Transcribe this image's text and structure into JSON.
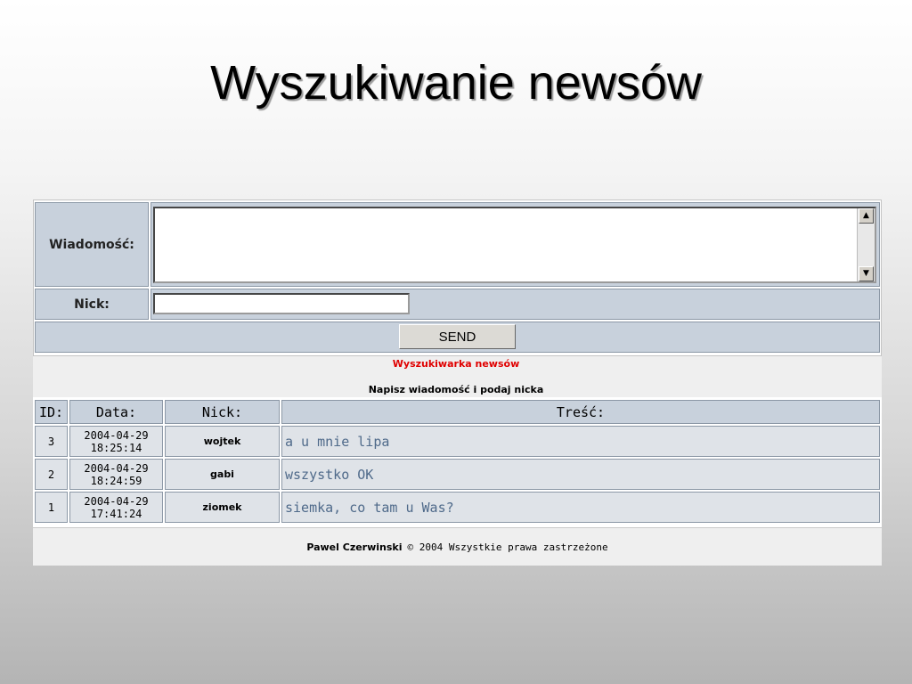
{
  "slide": {
    "title": "Wyszukiwanie newsów"
  },
  "form": {
    "message_label": "Wiadomość:",
    "message_value": "",
    "nick_label": "Nick:",
    "nick_value": "",
    "send_label": "SEND"
  },
  "info": {
    "title": "Wyszukiwarka newsów",
    "subtitle": "Napisz wiadomość i podaj nicka"
  },
  "table": {
    "headers": [
      "ID:",
      "Data:",
      "Nick:",
      "Treść:"
    ],
    "rows": [
      {
        "id": "3",
        "date": "2004-04-29",
        "time": "18:25:14",
        "nick": "wojtek",
        "message": "a u mnie lipa"
      },
      {
        "id": "2",
        "date": "2004-04-29",
        "time": "18:24:59",
        "nick": "gabi",
        "message": "wszystko OK"
      },
      {
        "id": "1",
        "date": "2004-04-29",
        "time": "17:41:24",
        "nick": "ziomek",
        "message": "siemka, co tam u Was?"
      }
    ]
  },
  "footer": {
    "author": "Pawel Czerwinski",
    "copyright": "© 2004 Wszystkie prawa zastrzeżone"
  }
}
